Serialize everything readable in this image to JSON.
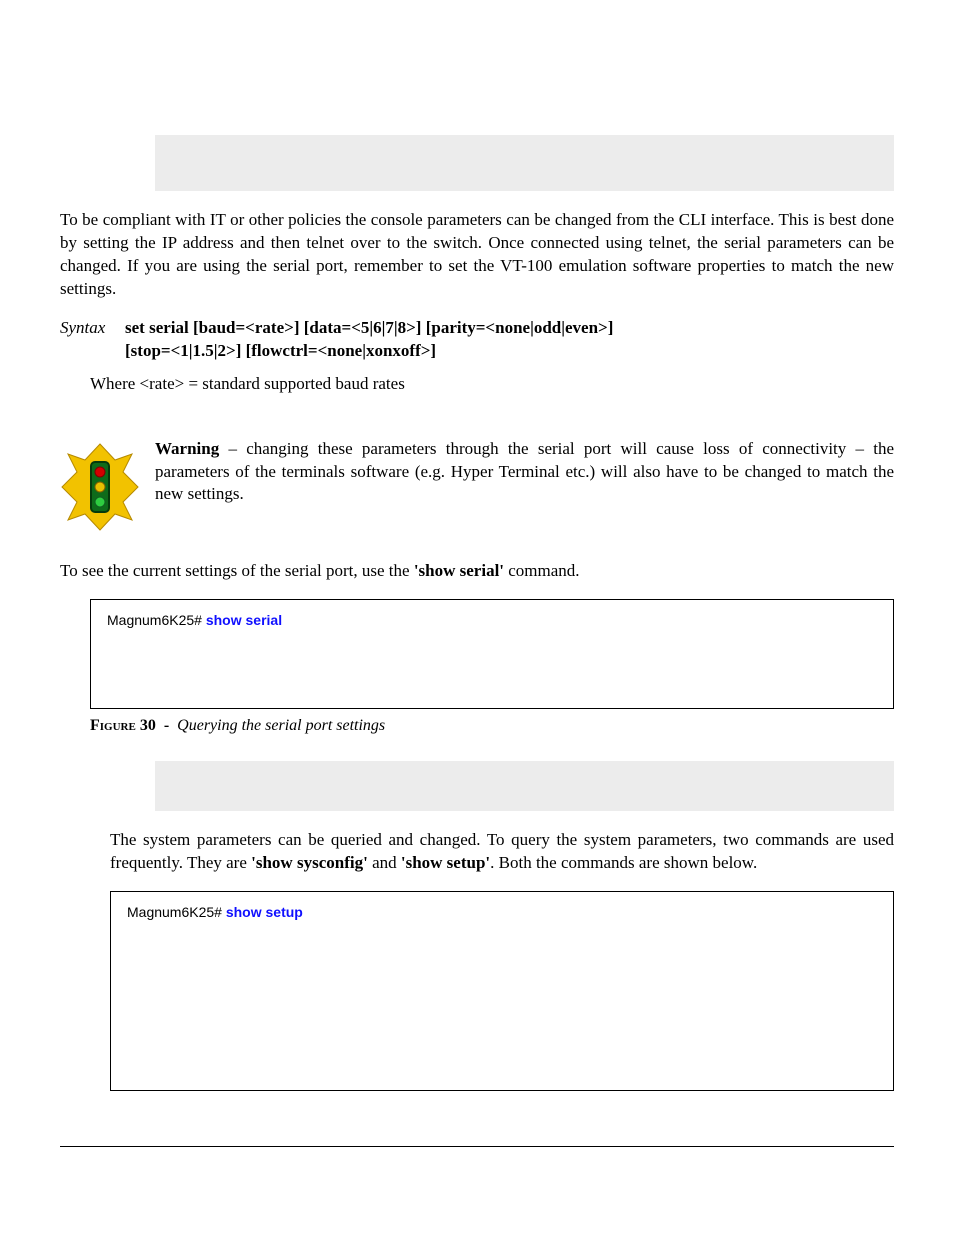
{
  "para1": "To be compliant with IT or other policies the console parameters can be changed from the CLI interface. This is best done by setting the IP address and then telnet over to the switch. Once connected using telnet, the serial parameters can be changed. If you are using the serial port, remember to set the VT-100 emulation software properties to match the new settings.",
  "syntax": {
    "label": "Syntax",
    "line1": "set serial [baud=<rate>] [data=<5|6|7|8>] [parity=<none|odd|even>] ",
    "line2": "[stop=<1|1.5|2>] [flowctrl=<none|xonxoff>]"
  },
  "where": "Where <rate> = standard supported baud rates",
  "warning": {
    "label": "Warning",
    "text": " – changing these parameters through the serial port will cause loss of connectivity – the parameters of the terminals software (e.g. Hyper Terminal etc.) will also have to be changed to match the new settings."
  },
  "para_followup_pre": "To see the current settings of the serial port, use the ",
  "show_serial_quoted": "'show serial'",
  "para_followup_post": " command.",
  "terminal1": {
    "prompt": "Magnum6K25# ",
    "command": "show serial"
  },
  "figure30": {
    "label": "Figure",
    "num": "30",
    "dash": "-",
    "title": "Querying the serial port settings"
  },
  "para2_pre": "The system parameters can be queried and changed. To query the system parameters, two commands are used frequently. They are ",
  "show_sysconfig_quoted": "'show sysconfig'",
  "and_word": " and ",
  "show_setup_quoted": "'show setup'",
  "para2_post": ". Both the commands are shown below.",
  "terminal2": {
    "prompt": "Magnum6K25# ",
    "command": "show setup"
  }
}
